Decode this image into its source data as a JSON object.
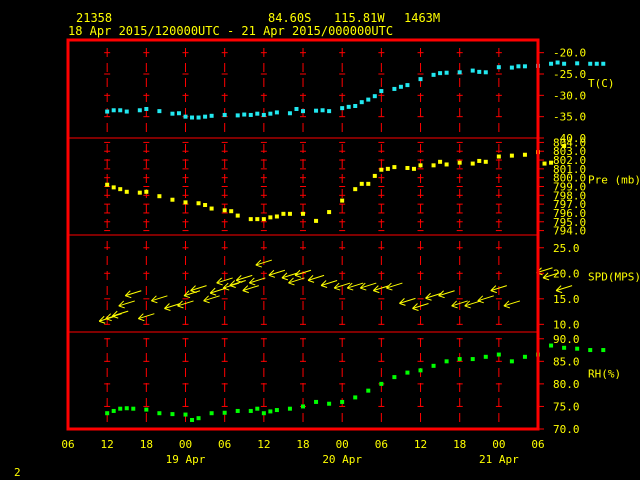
{
  "header": {
    "station": "21358",
    "lat": "84.60S",
    "lon": "115.81W",
    "elev": "1463M",
    "period": "18 Apr 2015/120000UTC - 21 Apr 2015/000000UTC"
  },
  "corner_label": "2",
  "colors": {
    "background": "#000000",
    "frame": "#ff0000",
    "text": "#ffff00",
    "temperature": "#22e8f0",
    "pressure": "#ffff00",
    "wind": "#ffff00",
    "humidity": "#00ff00"
  },
  "chart_data": {
    "type": "scatter",
    "x_axis": {
      "hour_ticks": [
        "06",
        "12",
        "18",
        "00",
        "06",
        "12",
        "18",
        "00",
        "06",
        "12",
        "18",
        "00",
        "06"
      ],
      "day_labels": [
        "19 Apr",
        "20 Apr",
        "21 Apr"
      ],
      "xlim": [
        "18 Apr 2015 06Z",
        "21 Apr 2015 06Z"
      ]
    },
    "panels": [
      {
        "id": "temperature",
        "label": "T(C)",
        "ylim": [
          -40,
          -17.5
        ],
        "ticks": [
          "-20.0",
          "-25.0",
          "-30.0",
          "-35.0",
          "-40.0"
        ],
        "tick_values": [
          -20,
          -25,
          -30,
          -35,
          -40
        ],
        "series": [
          {
            "x_hours": [
              12,
              13,
              14,
              15,
              17,
              18,
              20,
              22,
              23,
              24,
              25,
              26,
              27,
              28,
              30,
              32,
              33,
              34,
              35,
              36,
              37,
              38,
              40,
              41,
              42,
              44,
              45,
              46,
              48,
              49,
              50,
              51,
              52,
              53,
              54,
              56,
              57,
              58,
              60,
              62,
              63,
              64,
              66,
              68,
              69,
              70,
              72,
              74,
              75,
              76,
              78,
              80,
              81,
              82,
              84,
              86,
              87,
              88
            ],
            "values": [
              -33.8,
              -33.5,
              -33.5,
              -33.8,
              -33.5,
              -33.2,
              -33.7,
              -34.3,
              -34.2,
              -35.0,
              -35.2,
              -35.2,
              -35.0,
              -34.8,
              -34.6,
              -34.7,
              -34.5,
              -34.6,
              -34.3,
              -34.6,
              -34.3,
              -34.0,
              -34.2,
              -33.2,
              -33.7,
              -33.6,
              -33.5,
              -33.7,
              -33.0,
              -32.7,
              -32.5,
              -31.6,
              -31.0,
              -30.2,
              -29.0,
              -28.5,
              -28.0,
              -27.6,
              -26.2,
              -25.2,
              -24.8,
              -24.7,
              -24.6,
              -24.2,
              -24.5,
              -24.6,
              -23.4,
              -23.5,
              -23.2,
              -23.2,
              -23.1,
              -22.6,
              -22.3,
              -22.6,
              -22.5,
              -22.6,
              -22.6,
              -22.6
            ]
          }
        ]
      },
      {
        "id": "pressure",
        "label": "Pre (mb)",
        "ylim": [
          793.5,
          804.5
        ],
        "ticks": [
          "804.0",
          "803.0",
          "802.0",
          "801.0",
          "800.0",
          "799.0",
          "798.0",
          "797.0",
          "796.0",
          "795.0",
          "794.0"
        ],
        "tick_values": [
          804,
          803,
          802,
          801,
          800,
          799,
          798,
          797,
          796,
          795,
          794
        ],
        "series": [
          {
            "x_hours": [
              12,
              13,
              14,
              15,
              17,
              18,
              20,
              22,
              24,
              26,
              27,
              28,
              30,
              31,
              32,
              34,
              35,
              36,
              37,
              38,
              39,
              40,
              42,
              44,
              46,
              48,
              50,
              51,
              52,
              53,
              54,
              55,
              56,
              58,
              59,
              60,
              62,
              63,
              64,
              66,
              68,
              69,
              70,
              72,
              74,
              76,
              78,
              79,
              80,
              82
            ],
            "values": [
              799.2,
              798.9,
              798.7,
              798.4,
              798.3,
              798.4,
              797.9,
              797.5,
              797.2,
              797.1,
              796.9,
              796.5,
              796.3,
              796.2,
              795.7,
              795.3,
              795.3,
              795.3,
              795.5,
              795.6,
              795.9,
              795.9,
              795.9,
              795.1,
              796.1,
              797.4,
              798.7,
              799.3,
              799.3,
              800.2,
              800.9,
              801.0,
              801.2,
              801.1,
              801.0,
              801.4,
              801.4,
              801.8,
              801.5,
              801.7,
              801.6,
              801.9,
              801.8,
              802.4,
              802.5,
              802.6,
              802.9,
              801.6,
              801.7,
              803.6
            ]
          }
        ]
      },
      {
        "id": "wind",
        "label": "SPD(MPS)",
        "ylim": [
          8.5,
          27.5
        ],
        "ticks": [
          "25.0",
          "20.0",
          "15.0",
          "10.0"
        ],
        "tick_values": [
          25,
          20,
          15,
          10
        ],
        "series": [
          {
            "x_hours": [
              12,
              13,
              14,
              15,
              16,
              18,
              20,
              22,
              24,
              25,
              26,
              28,
              29,
              30,
              31,
              32,
              33,
              34,
              35,
              36,
              38,
              40,
              41,
              42,
              44,
              46,
              48,
              50,
              52,
              54,
              56,
              58,
              60,
              62,
              64,
              66,
              68,
              70,
              72,
              74,
              79,
              80,
              82
            ],
            "values": [
              11.0,
              11.5,
              12.0,
              14.0,
              16.0,
              11.5,
              15.0,
              13.5,
              14.0,
              16.0,
              17.0,
              15.0,
              16.5,
              18.5,
              17.5,
              18.0,
              19.0,
              17.0,
              18.5,
              22.0,
              20.0,
              19.5,
              18.5,
              20.0,
              19.0,
              18.0,
              17.5,
              17.5,
              17.5,
              17.0,
              17.5,
              14.5,
              13.5,
              15.5,
              16.0,
              14.0,
              14.0,
              15.0,
              17.0,
              14.0,
              20.5,
              19.5,
              17.0
            ]
          }
        ]
      },
      {
        "id": "humidity",
        "label": "RH(%)",
        "ylim": [
          70,
          91.5
        ],
        "ticks": [
          "90.0",
          "85.0",
          "80.0",
          "75.0",
          "70.0"
        ],
        "tick_values": [
          90,
          85,
          80,
          75,
          70
        ],
        "series": [
          {
            "x_hours": [
              12,
              13,
              14,
              15,
              16,
              18,
              20,
              22,
              24,
              25,
              26,
              28,
              30,
              32,
              34,
              35,
              36,
              37,
              38,
              40,
              42,
              44,
              46,
              48,
              50,
              52,
              54,
              56,
              58,
              60,
              62,
              64,
              66,
              68,
              70,
              72,
              74,
              76,
              78,
              80,
              82,
              84,
              86,
              88
            ],
            "values": [
              73.5,
              74.0,
              74.5,
              74.6,
              74.5,
              74.3,
              73.5,
              73.3,
              73.2,
              72.0,
              72.4,
              73.5,
              73.6,
              74.0,
              74.0,
              74.5,
              73.5,
              73.9,
              74.2,
              74.5,
              75.0,
              76.0,
              75.6,
              76.0,
              77.0,
              78.5,
              80.0,
              81.5,
              82.5,
              83.0,
              84.0,
              85.0,
              85.5,
              85.5,
              86.0,
              86.5,
              85.0,
              86.0,
              86.5,
              88.5,
              88.0,
              87.8,
              87.5,
              87.5
            ]
          }
        ]
      }
    ]
  }
}
